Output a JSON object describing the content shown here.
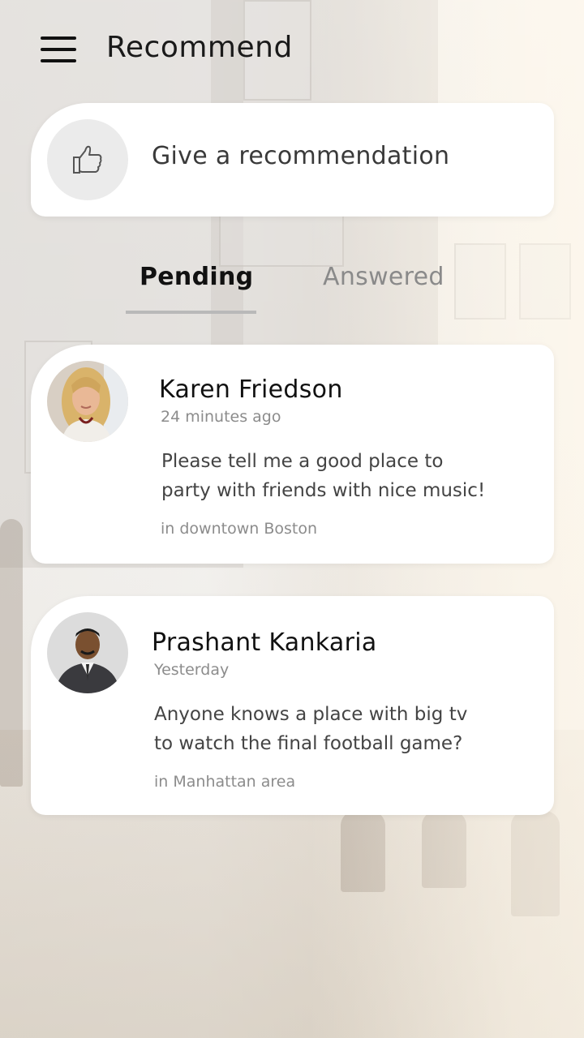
{
  "header": {
    "title": "Recommend",
    "menu_icon": "hamburger-menu-icon"
  },
  "give_recommendation": {
    "label": "Give a recommendation",
    "icon": "thumbs-up-icon"
  },
  "tabs": [
    {
      "label": "Pending",
      "active": true
    },
    {
      "label": "Answered",
      "active": false
    }
  ],
  "requests": [
    {
      "name": "Karen Friedson",
      "time": "24 minutes ago",
      "message_lines": [
        "Please tell me a good place to",
        "party with friends with nice music!"
      ],
      "location": "in downtown Boston"
    },
    {
      "name": "Prashant Kankaria",
      "time": "Yesterday",
      "message_lines": [
        "Anyone knows a place with big tv",
        "to watch the final football game?"
      ],
      "location": "in Manhattan area"
    }
  ],
  "colors": {
    "card_bg": "#ffffff",
    "icon_circle_bg": "#ebebeb",
    "tab_active": "#111111",
    "tab_inactive": "#8a8a8a",
    "tab_underline": "#b9b9b9",
    "secondary_text": "#8c8c8c"
  }
}
